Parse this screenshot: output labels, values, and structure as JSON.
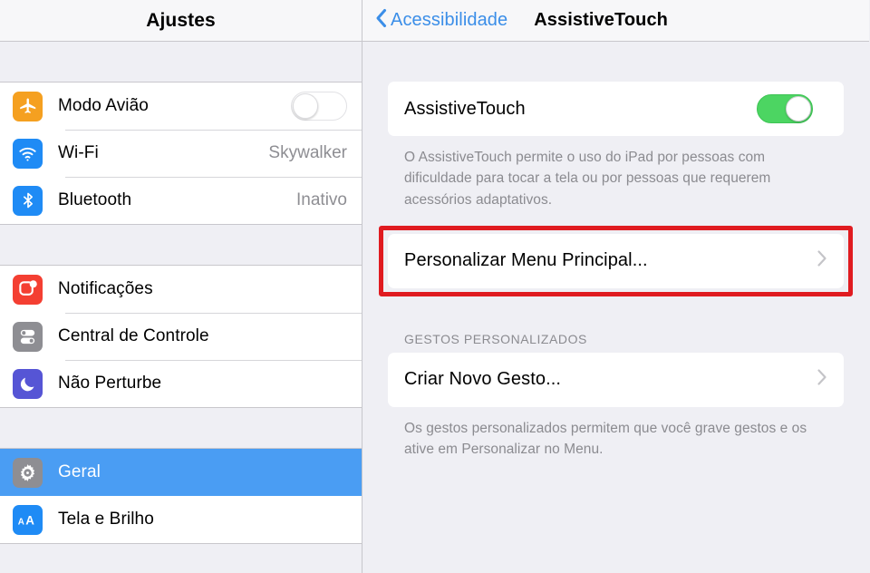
{
  "sidebar": {
    "title": "Ajustes",
    "groups": [
      {
        "rows": [
          {
            "label": "Modo Avião",
            "icon": "airplane-icon",
            "icon_bg": "#f5a020",
            "control": "toggle",
            "toggle_on": false
          },
          {
            "label": "Wi-Fi",
            "icon": "wifi-icon",
            "icon_bg": "#1f8bf5",
            "control": "value",
            "value": "Skywalker"
          },
          {
            "label": "Bluetooth",
            "icon": "bluetooth-icon",
            "icon_bg": "#1f8bf5",
            "control": "value",
            "value": "Inativo"
          }
        ]
      },
      {
        "rows": [
          {
            "label": "Notificações",
            "icon": "notifications-icon",
            "icon_bg": "#f43f32",
            "control": "none"
          },
          {
            "label": "Central de Controle",
            "icon": "control-center-icon",
            "icon_bg": "#8e8e93",
            "control": "none"
          },
          {
            "label": "Não Perturbe",
            "icon": "moon-icon",
            "icon_bg": "#5655d5",
            "control": "none"
          }
        ]
      },
      {
        "rows": [
          {
            "label": "Geral",
            "icon": "gear-icon",
            "icon_bg": "#8e8e93",
            "control": "none",
            "selected": true
          },
          {
            "label": "Tela e Brilho",
            "icon": "display-brightness-icon",
            "icon_bg": "#1f8bf5",
            "control": "none"
          }
        ]
      }
    ]
  },
  "detail": {
    "back_label": "Acessibilidade",
    "title": "AssistiveTouch",
    "assistive_touch": {
      "label": "AssistiveTouch",
      "toggle_on": true,
      "footnote": "O AssistiveTouch permite o uso do iPad por pessoas com dificuldade para tocar a tela ou por pessoas que requerem acessórios adaptativos."
    },
    "customize_menu": {
      "label": "Personalizar Menu Principal...",
      "highlighted": true,
      "highlight_color": "#e01b20"
    },
    "gestures": {
      "section_label": "GESTOS PERSONALIZADOS",
      "create_label": "Criar Novo Gesto...",
      "footnote": "Os gestos personalizados permitem que você grave gestos e os ative em Personalizar no Menu."
    }
  },
  "colors": {
    "accent_blue": "#3b8ee8",
    "selected_row": "#4a9df3",
    "toggle_green": "#4cd562",
    "page_bg": "#efeff4"
  }
}
